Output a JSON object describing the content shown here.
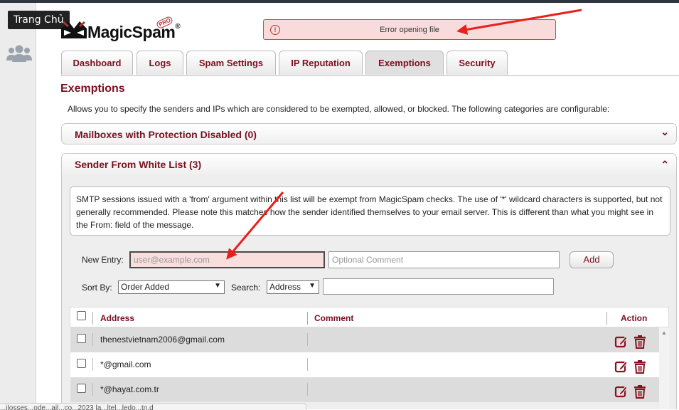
{
  "tooltip": "Trang Chủ",
  "logo": {
    "text": "MagicSpam",
    "reg": "®",
    "badge": "PRO"
  },
  "error": {
    "message": "Error opening file"
  },
  "tabs": [
    {
      "label": "Dashboard"
    },
    {
      "label": "Logs"
    },
    {
      "label": "Spam Settings"
    },
    {
      "label": "IP Reputation"
    },
    {
      "label": "Exemptions"
    },
    {
      "label": "Security"
    }
  ],
  "page": {
    "title": "Exemptions",
    "description": "Allows you to specify the senders and IPs which are considered to be exempted, allowed, or blocked. The following categories are configurable:"
  },
  "sections": {
    "mailboxes": {
      "title": "Mailboxes with Protection Disabled (0)",
      "chevron": "⌄"
    },
    "whitelist": {
      "title": "Sender From White List (3)",
      "chevron": "⌃"
    }
  },
  "info": "SMTP sessions issued with a 'from' argument within this list will be exempt from MagicSpam checks. The use of '*' wildcard characters is supported, but not generally recommended. Please note this matches how the sender identified themselves to your email server. This is different than what you might see in the From: field of the message.",
  "entry": {
    "label": "New Entry:",
    "address_placeholder": "user@example.com",
    "comment_placeholder": "Optional Comment",
    "add_label": "Add"
  },
  "sort": {
    "label": "Sort By:",
    "value": "Order Added",
    "search_label": "Search:",
    "search_field": "Address",
    "search_value": ""
  },
  "table": {
    "headers": {
      "address": "Address",
      "comment": "Comment",
      "action": "Action"
    },
    "rows": [
      {
        "address": "thenestvietnam2006@gmail.com",
        "comment": ""
      },
      {
        "address": "*@gmail.com",
        "comment": ""
      },
      {
        "address": "*@hayat.com.tr",
        "comment": ""
      }
    ]
  },
  "status_url": "...ilosses...ode...ail...co...2023 la...ltel...ledo...tn.d",
  "colors": {
    "accent": "#7a1020",
    "error_bg": "#f8dcdc",
    "arrow": "#e8201c"
  }
}
